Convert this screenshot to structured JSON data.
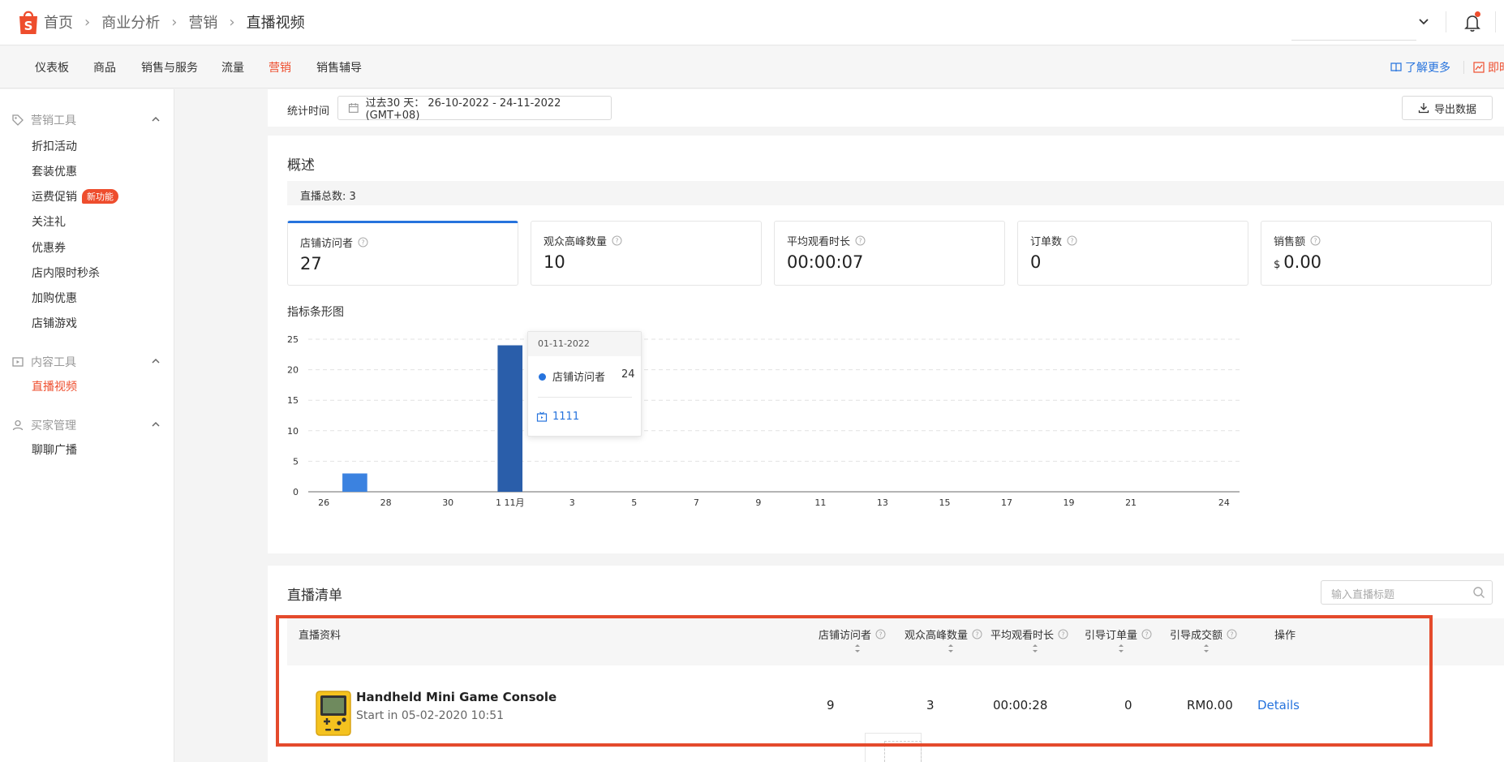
{
  "breadcrumb": [
    "首页",
    "商业分析",
    "营销",
    "直播视频"
  ],
  "main_nav": {
    "items": [
      "仪表板",
      "商品",
      "销售与服务",
      "流量",
      "营销",
      "销售辅导"
    ],
    "active": "营销",
    "learn_more": "了解更多",
    "instant": "即时"
  },
  "sidebar": {
    "groups": [
      {
        "title": "营销工具",
        "items": [
          "折扣活动",
          "套装优惠",
          "运费促销",
          "关注礼",
          "优惠券",
          "店内限时秒杀",
          "加购优惠",
          "店铺游戏"
        ]
      },
      {
        "title": "内容工具",
        "items": [
          "直播视频"
        ]
      },
      {
        "title": "买家管理",
        "items": [
          "聊聊广播"
        ]
      }
    ],
    "new_badge": "新功能",
    "active_item": "直播视频"
  },
  "time": {
    "label": "统计时间",
    "range": "过去30 天： 26-10-2022 - 24-11-2022 (GMT+08)",
    "export": "导出数据"
  },
  "overview": {
    "title": "概述",
    "total": "直播总数: 3",
    "metrics": [
      {
        "label": "店铺访问者",
        "value": "27"
      },
      {
        "label": "观众高峰数量",
        "value": "10"
      },
      {
        "label": "平均观看时长",
        "value": "00:00:07"
      },
      {
        "label": "订单数",
        "value": "0"
      },
      {
        "label": "销售额",
        "currency": "$",
        "value": "0.00"
      }
    ]
  },
  "chart_data": {
    "type": "bar",
    "title": "指标条形图",
    "x_tick_labels": [
      "26",
      "28",
      "30",
      "1 11月",
      "3",
      "5",
      "7",
      "9",
      "11",
      "13",
      "15",
      "17",
      "19",
      "21",
      "24"
    ],
    "y_ticks": [
      0,
      5,
      10,
      15,
      20,
      25
    ],
    "ylim": [
      0,
      25
    ],
    "series": [
      {
        "name": "店铺访问者",
        "points": [
          {
            "date": "27-10-2022",
            "value": 3
          },
          {
            "date": "01-11-2022",
            "value": 24
          }
        ]
      }
    ],
    "grid": true,
    "colors": {
      "normal": "#3b82e0",
      "hover": "#2a5eaa"
    },
    "tooltip": {
      "date": "01-11-2022",
      "series": "店铺访问者",
      "value": "24",
      "live": "1111"
    }
  },
  "live_list": {
    "title": "直播清单",
    "search_placeholder": "输入直播标题",
    "columns": [
      "直播资料",
      "店铺访问者",
      "观众高峰数量",
      "平均观看时长",
      "引导订单量",
      "引导成交额",
      "操作"
    ],
    "rows": [
      {
        "name": "Handheld Mini Game Console",
        "start": "Start in 05-02-2020 10:51",
        "visitors": "9",
        "peak": "3",
        "avg": "00:00:28",
        "orders": "0",
        "sales": "RM0.00",
        "action": "Details"
      }
    ]
  }
}
